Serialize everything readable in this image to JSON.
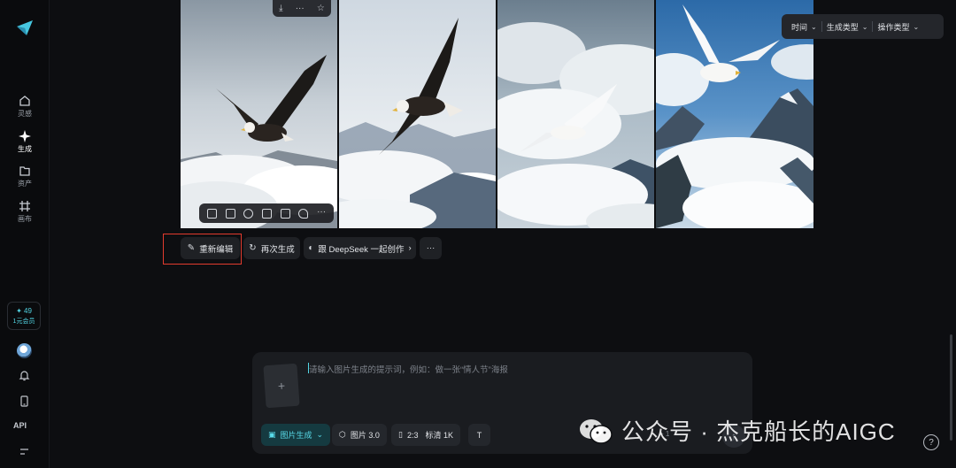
{
  "sidebar": {
    "items": [
      {
        "label": "灵感",
        "icon": "home-icon"
      },
      {
        "label": "生成",
        "icon": "sparkle-icon"
      },
      {
        "label": "资产",
        "icon": "folder-icon"
      },
      {
        "label": "画布",
        "icon": "canvas-icon"
      }
    ],
    "promo": {
      "line1": "✦ 49",
      "line2": "1元会员"
    },
    "api_label": "API"
  },
  "filters": [
    {
      "label": "时间"
    },
    {
      "label": "生成类型"
    },
    {
      "label": "操作类型"
    }
  ],
  "actions": {
    "reedit": "重新编辑",
    "regenerate": "再次生成",
    "deepseek": "跟 DeepSeek 一起创作",
    "more": "···"
  },
  "prompt": {
    "placeholder": "请输入图片生成的提示词，例如：做一张“情人节”海报",
    "add_symbol": "+",
    "mode": "图片生成",
    "model": "图片 3.0",
    "ratio": "2:3",
    "quality": "标清 1K",
    "count_text": "+ 1"
  },
  "watermark": {
    "text": "公众号 · 杰克船长的AIGC"
  },
  "help_symbol": "?",
  "colors": {
    "accent": "#53d6e5",
    "highlight": "#e23b2e",
    "background": "#0d0e11"
  }
}
